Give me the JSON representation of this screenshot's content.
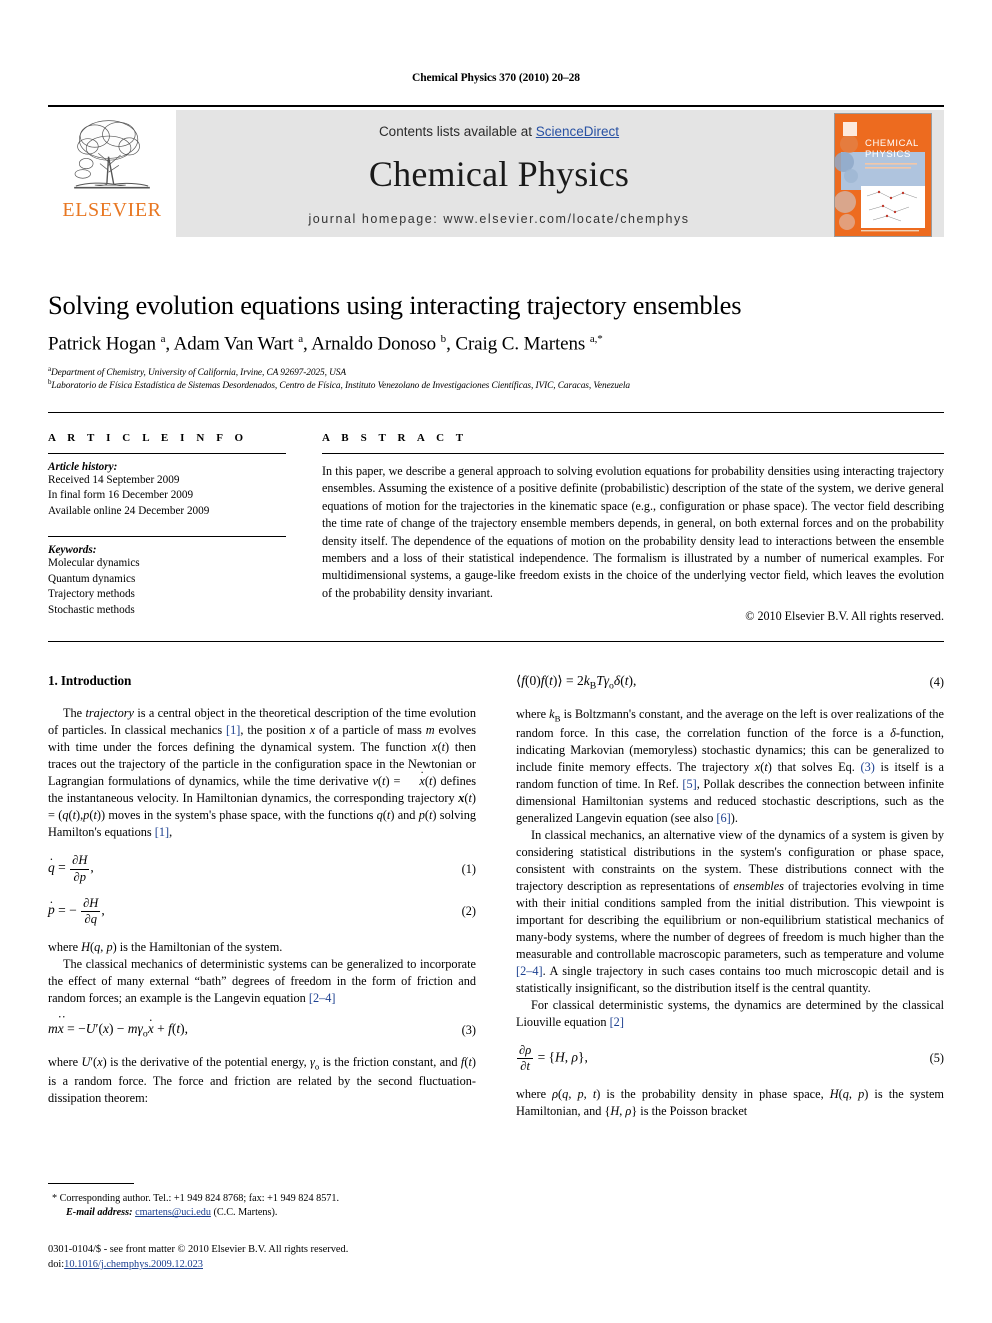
{
  "running_head": "Chemical Physics 370 (2010) 20–28",
  "masthead": {
    "publisher": "ELSEVIER",
    "contents_prefix": "Contents lists available at ",
    "sciencedirect": "ScienceDirect",
    "journal_title": "Chemical Physics",
    "homepage": "journal homepage: www.elsevier.com/locate/chemphys",
    "cover_line1": "CHEMICAL",
    "cover_line2": "PHYSICS",
    "accent_orange": "#E87722",
    "link_blue": "#2851a3",
    "panel_gray": "#e4e4e4"
  },
  "article": {
    "title": "Solving evolution equations using interacting trajectory ensembles",
    "authors_html": "Patrick Hogan <sup>a</sup>, Adam Van Wart <sup>a</sup>, Arnaldo Donoso <sup>b</sup>, Craig C. Martens <sup>a,*</sup>",
    "affiliation_a": "Department of Chemistry, University of California, Irvine, CA 92697-2025, USA",
    "affiliation_b": "Laboratorio de Física Estadística de Sistemas Desordenados, Centro de Física, Instituto Venezolano de Investigaciones Científicas, IVIC, Caracas, Venezuela"
  },
  "info": {
    "heading": "A R T I C L E    I N F O",
    "history_label": "Article history:",
    "history": [
      "Received 14 September 2009",
      "In final form 16 December 2009",
      "Available online 24 December 2009"
    ],
    "keywords_label": "Keywords:",
    "keywords": [
      "Molecular dynamics",
      "Quantum dynamics",
      "Trajectory methods",
      "Stochastic methods"
    ]
  },
  "abstract": {
    "heading": "A B S T R A C T",
    "body": "In this paper, we describe a general approach to solving evolution equations for probability densities using interacting trajectory ensembles. Assuming the existence of a positive definite (probabilistic) description of the state of the system, we derive general equations of motion for the trajectories in the kinematic space (e.g., configuration or phase space). The vector field describing the time rate of change of the trajectory ensemble members depends, in general, on both external forces and on the probability density itself. The dependence of the equations of motion on the probability density lead to interactions between the ensemble members and a loss of their statistical independence. The formalism is illustrated by a number of numerical examples. For multidimensional systems, a gauge-like freedom exists in the choice of the underlying vector field, which leaves the evolution of the probability density invariant.",
    "copyright": "© 2010 Elsevier B.V. All rights reserved."
  },
  "body": {
    "section_heading": "1. Introduction",
    "left": {
      "p1_html": "The <i>trajectory</i> is a central object in the theoretical description of the time evolution of particles. In classical mechanics <span class=\"ref\">[1]</span>, the position <i>x</i> of a particle of mass <i>m</i> evolves with time under the forces defining the dynamical system. The function <i>x</i>(<i>t</i>) then traces out the trajectory of the particle in the configuration space in the Newtonian or Lagrangian formulations of dynamics, while the time derivative <i>v</i>(<i>t</i>) = <span class=\"ov\"><span class=\"dots\">.</span><i>x</i></span>(<i>t</i>) defines the instantaneous velocity. In Hamiltonian dynamics, the corresponding trajectory <b><i>x</i></b>(<i>t</i>) = (<i>q</i>(<i>t</i>),<i>p</i>(<i>t</i>)) moves in the system's phase space, with the functions <i>q</i>(<i>t</i>) and <i>p</i>(<i>t</i>) solving Hamilton's equations <span class=\"ref\">[1]</span>,",
      "eq1_num": "(1)",
      "eq2_num": "(2)",
      "p2_html": "where <i>H</i>(<i>q</i>, <i>p</i>) is the Hamiltonian of the system.",
      "p3_html": "The classical mechanics of deterministic systems can be generalized to incorporate the effect of many external “bath” degrees of freedom in the form of friction and random forces; an example is the Langevin equation <span class=\"ref\">[2–4]</span>",
      "eq3_num": "(3)",
      "p4_html": "where <i>U</i>′(<i>x</i>) is the derivative of the potential energy, <i>γ</i><span class=\"sub\">o</span> is the friction constant, and <i>f</i>(<i>t</i>) is a random force. The force and friction are related by the second fluctuation-dissipation theorem:"
    },
    "right": {
      "eq4_num": "(4)",
      "p1_html": "where <i>k</i><span class=\"sub\">B</span> is Boltzmann's constant, and the average on the left is over realizations of the random force. In this case, the correlation function of the force is a <i>δ</i>-function, indicating Markovian (memoryless) stochastic dynamics; this can be generalized to include finite memory effects. The trajectory <i>x</i>(<i>t</i>) that solves Eq. <span class=\"ref\">(3)</span> is itself is a random function of time. In Ref. <span class=\"ref\">[5]</span>, Pollak describes the connection between infinite dimensional Hamiltonian systems and reduced stochastic descriptions, such as the generalized Langevin equation (see also <span class=\"ref\">[6]</span>).",
      "p2_html": "In classical mechanics, an alternative view of the dynamics of a system is given by considering statistical distributions in the system's configuration or phase space, consistent with constraints on the system. These distributions connect with the trajectory description as representations of <i>ensembles</i> of trajectories evolving in time with their initial conditions sampled from the initial distribution. This viewpoint is important for describing the equilibrium or non-equilibrium statistical mechanics of many-body systems, where the number of degrees of freedom is much higher than the measurable and controllable macroscopic parameters, such as temperature and volume <span class=\"ref\">[2–4]</span>. A single trajectory in such cases contains too much microscopic detail and is statistically insignificant, so the distribution itself is the central quantity.",
      "p3_html": "For classical deterministic systems, the dynamics are determined by the classical Liouville equation <span class=\"ref\">[2]</span>",
      "eq5_num": "(5)",
      "p4_html": "where <i>ρ</i>(<i>q</i>, <i>p</i>, <i>t</i>) is the probability density in phase space, <i>H</i>(<i>q</i>, <i>p</i>) is the system Hamiltonian, and {<i>H</i>, <i>ρ</i>} is the Poisson bracket"
    }
  },
  "footnote": {
    "corresponding": "* Corresponding author. Tel.: +1 949 824 8768; fax: +1 949 824 8571.",
    "email_label": "E-mail address:",
    "email": "cmartens@uci.edu",
    "email_owner": "(C.C. Martens)."
  },
  "imprint": {
    "issn_line": "0301-0104/$ - see front matter © 2010 Elsevier B.V. All rights reserved.",
    "doi_label": "doi:",
    "doi": "10.1016/j.chemphys.2009.12.023"
  }
}
